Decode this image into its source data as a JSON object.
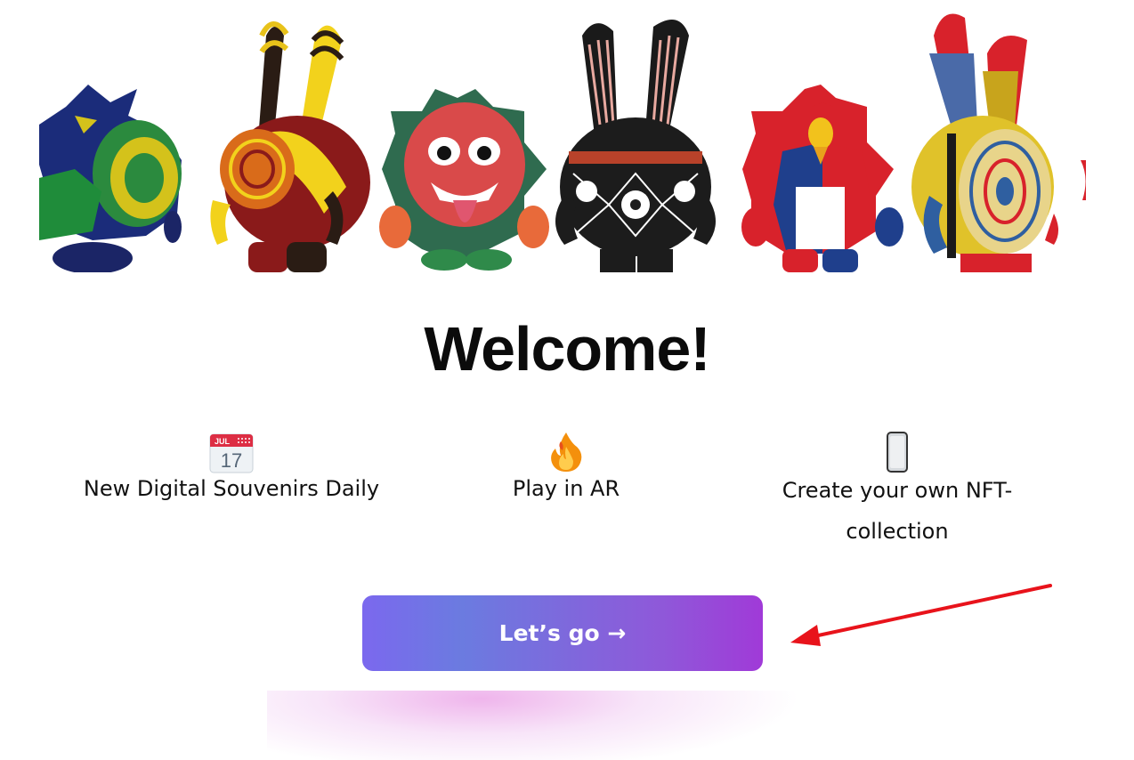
{
  "hero": {
    "figures": [
      "green-spiky-toy",
      "yellow-bunny-toy",
      "barong-mask-toy",
      "black-pattern-bunny-toy",
      "rooster-flag-toy",
      "patterned-bunny-toy"
    ]
  },
  "welcome": {
    "title": "Welcome!"
  },
  "features": [
    {
      "icon": "calendar-icon",
      "label": "New Digital Souvenirs Daily",
      "calendar_month": "JUL",
      "calendar_day": "17"
    },
    {
      "icon": "fire-icon",
      "label": "Play in AR"
    },
    {
      "icon": "phone-icon",
      "label": "Create your own NFT-collection"
    }
  ],
  "cta": {
    "label": "Let’s go →"
  },
  "colors": {
    "button_gradient_start": "#7b68ee",
    "button_gradient_end": "#a03ad8",
    "annotation_arrow": "#e8131b"
  }
}
